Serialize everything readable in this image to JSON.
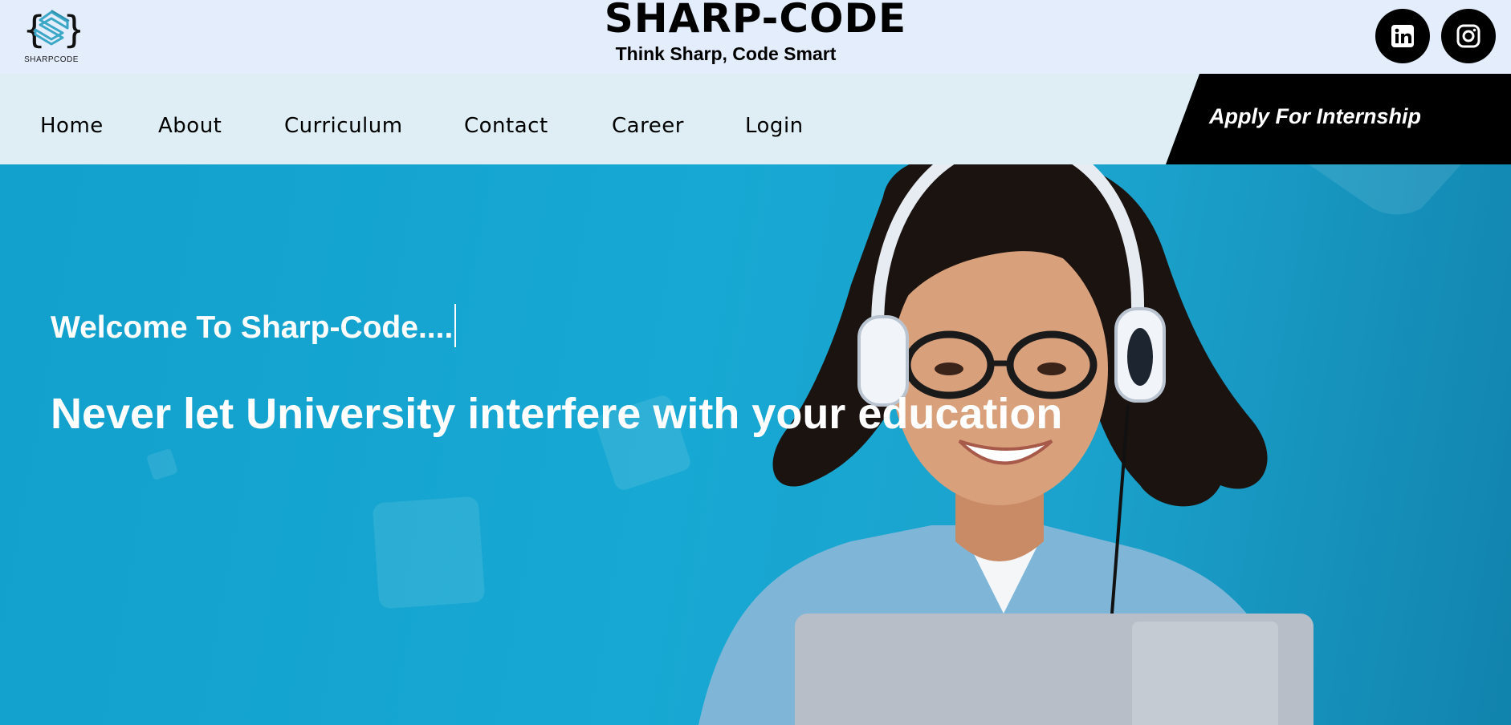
{
  "header": {
    "logo_text": "SHARPCODE",
    "brand": "SHARP-CODE",
    "tagline": "Think Sharp, Code Smart",
    "social": [
      {
        "name": "linkedin",
        "icon": "linkedin-icon"
      },
      {
        "name": "instagram",
        "icon": "instagram-icon"
      }
    ]
  },
  "nav": {
    "items": [
      "Home",
      "About",
      "Curriculum",
      "Contact",
      "Career",
      "Login"
    ],
    "apply_label": "Apply For Internship"
  },
  "hero": {
    "welcome": "Welcome To Sharp-Code....",
    "headline": "Never let University interfere with your education"
  },
  "colors": {
    "header_bg": "#e4edfb",
    "nav_bg": "#deeef4",
    "hero_blue": "#17a8d3",
    "accent_black": "#000000",
    "logo_teal": "#3aa7c7"
  }
}
